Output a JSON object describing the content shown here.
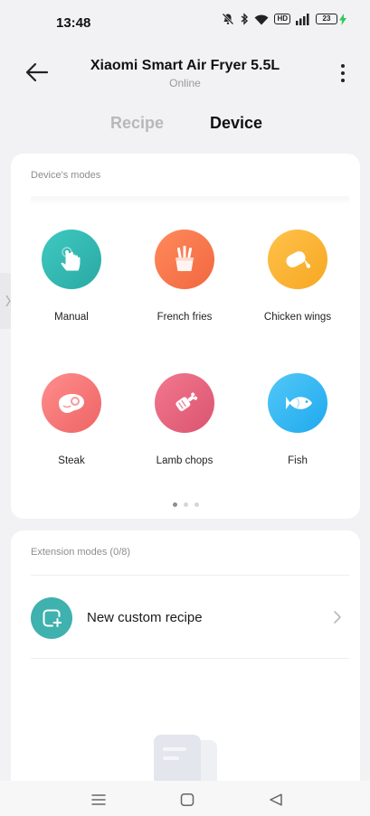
{
  "status_bar": {
    "time": "13:48",
    "hd_badge": "HD",
    "battery_level": "23",
    "icons": [
      "mute-bell-icon",
      "bluetooth-icon",
      "wifi-icon",
      "hd-badge",
      "signal-icon",
      "battery-icon",
      "charging-icon"
    ]
  },
  "header": {
    "back_icon": "arrow-left-icon",
    "title": "Xiaomi Smart Air Fryer 5.5L",
    "status": "Online",
    "more_icon": "more-vertical-icon"
  },
  "tabs": [
    {
      "label": "Recipe",
      "active": false
    },
    {
      "label": "Device",
      "active": true
    }
  ],
  "modes": {
    "section_label": "Device's modes",
    "items": [
      {
        "label": "Manual",
        "icon": "hand-tap-icon",
        "color_from": "#3ec9c1",
        "color_to": "#2aa9a3"
      },
      {
        "label": "French fries",
        "icon": "fries-icon",
        "color_from": "#ff8a5c",
        "color_to": "#f2673f"
      },
      {
        "label": "Chicken wings",
        "icon": "chicken-wing-icon",
        "color_from": "#ffc24a",
        "color_to": "#f7a722"
      },
      {
        "label": "Steak",
        "icon": "steak-icon",
        "color_from": "#ff8d8d",
        "color_to": "#ee6464"
      },
      {
        "label": "Lamb chops",
        "icon": "lamb-chop-icon",
        "color_from": "#f2788e",
        "color_to": "#db5470"
      },
      {
        "label": "Fish",
        "icon": "fish-icon",
        "color_from": "#52c8f7",
        "color_to": "#1fa9ee"
      }
    ],
    "page_count": 3,
    "current_page": 1
  },
  "extension": {
    "section_label": "Extension modes (0/8)",
    "new_recipe_label": "New custom recipe",
    "add_icon": "add-square-icon",
    "chevron_icon": "chevron-right-icon",
    "accent": "#3fb1ae"
  },
  "nav_bar": {
    "icons": [
      "menu-icon",
      "home-square-icon",
      "back-triangle-icon"
    ]
  }
}
